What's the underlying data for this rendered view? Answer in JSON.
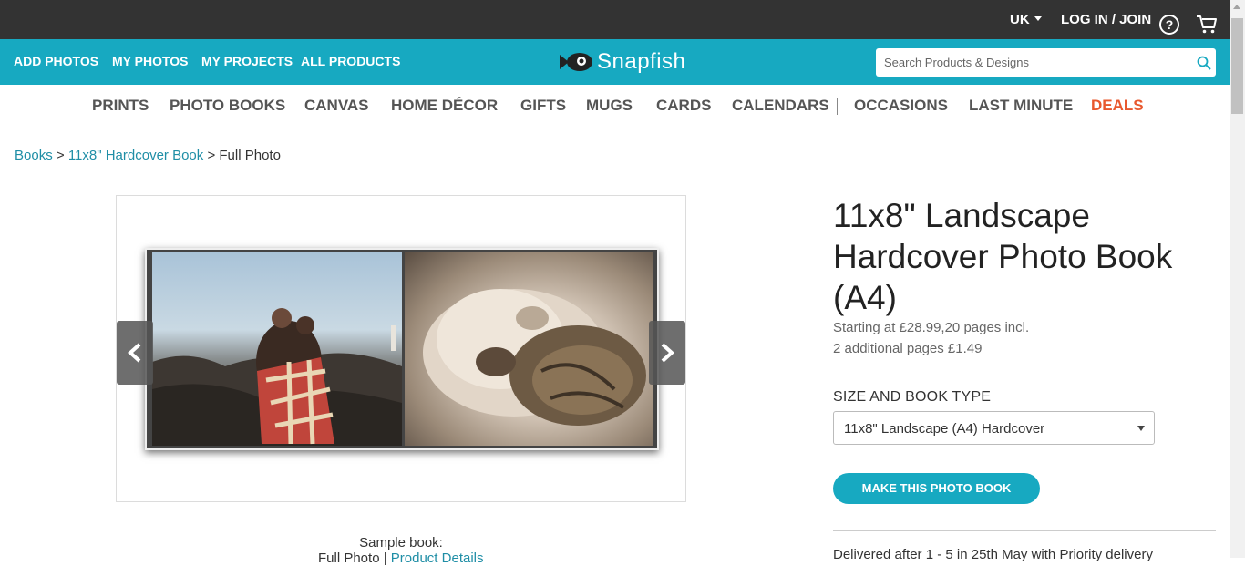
{
  "topbar": {
    "region": "UK",
    "login": "LOG IN / JOIN",
    "help": "?"
  },
  "nav": {
    "links": [
      "ADD PHOTOS",
      "MY PHOTOS",
      "MY PROJECTS",
      "ALL PRODUCTS"
    ],
    "logo": "Snapfish",
    "search_placeholder": "Search Products & Designs"
  },
  "categories": [
    "PRINTS",
    "PHOTO BOOKS",
    "CANVAS",
    "HOME DÉCOR",
    "GIFTS",
    "MUGS",
    "CARDS",
    "CALENDARS",
    "OCCASIONS",
    "LAST MINUTE",
    "DEALS"
  ],
  "breadcrumb": {
    "items": [
      "Books",
      "11x8\" Hardcover Book",
      "Full Photo"
    ],
    "sep": ">"
  },
  "gallery": {
    "caption": "Sample book:",
    "caption_line2_plain": "Full Photo",
    "caption_line2_sep": " | ",
    "caption_line2_link": "Product Details"
  },
  "product": {
    "title": "11x8\" Landscape Hardcover Photo Book (A4)",
    "price_line1": "Starting at £28.99,20 pages incl.",
    "price_line2": "2 additional pages £1.49",
    "size_label": "SIZE AND BOOK TYPE",
    "size_value": "11x8\" Landscape (A4) Hardcover",
    "cta": "MAKE THIS PHOTO BOOK",
    "delivery": "Delivered after 1 - 5 in 25th May with Priority delivery"
  },
  "colors": {
    "accent": "#17a9c1",
    "topbar": "#333333",
    "deals": "#e8582e",
    "link": "#1f8ea6"
  }
}
